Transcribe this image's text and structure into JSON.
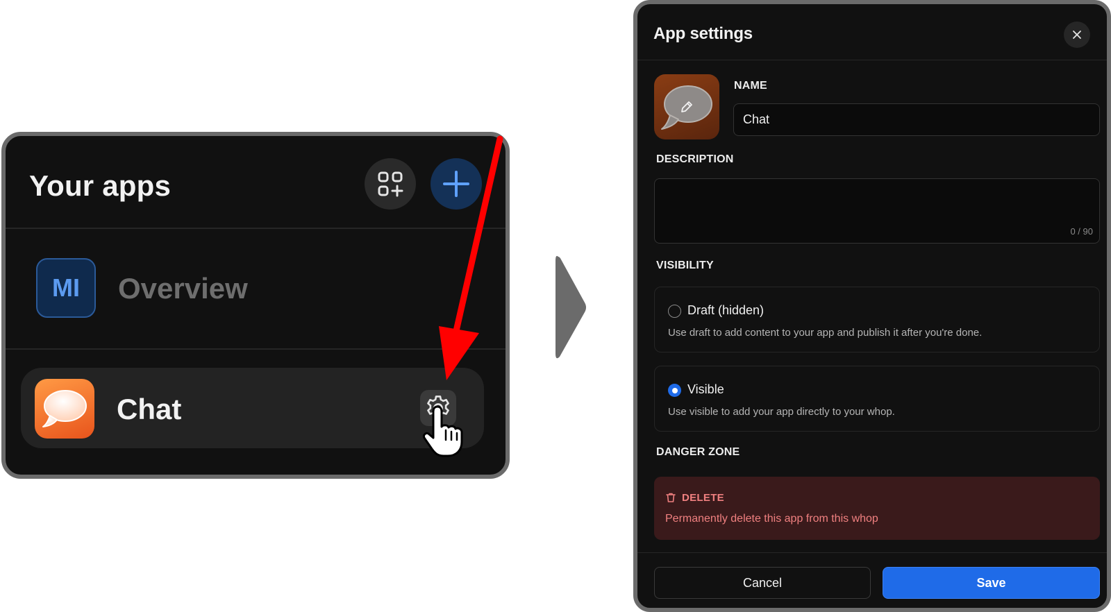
{
  "apps_panel": {
    "title": "Your apps",
    "header_buttons": [
      {
        "icon": "apps-grid-plus-icon"
      },
      {
        "icon": "plus-icon"
      }
    ],
    "apps": [
      {
        "initials": "MI",
        "label": "Overview",
        "state": "inactive"
      },
      {
        "label": "Chat",
        "icon": "chat-bubble-icon",
        "settings_icon": "gear-icon",
        "state": "hovered"
      }
    ]
  },
  "dialog": {
    "title": "App settings",
    "name_label": "NAME",
    "name_value": "Chat",
    "description_label": "DESCRIPTION",
    "description_value": "",
    "description_count": "0 / 90",
    "visibility_label": "VISIBILITY",
    "visibility_options": [
      {
        "title": "Draft (hidden)",
        "description": "Use draft to add content to your app and publish it after you're done.",
        "selected": false
      },
      {
        "title": "Visible",
        "description": "Use visible to add your app directly to your whop.",
        "selected": true
      }
    ],
    "danger_label": "DANGER ZONE",
    "delete_title": "DELETE",
    "delete_description": "Permanently delete this app from this whop",
    "cancel_label": "Cancel",
    "save_label": "Save"
  },
  "colors": {
    "accent_blue": "#1f6be8",
    "danger_text": "#f08080",
    "danger_bg": "#3a1a1b",
    "annotation_red": "#ff0000"
  }
}
